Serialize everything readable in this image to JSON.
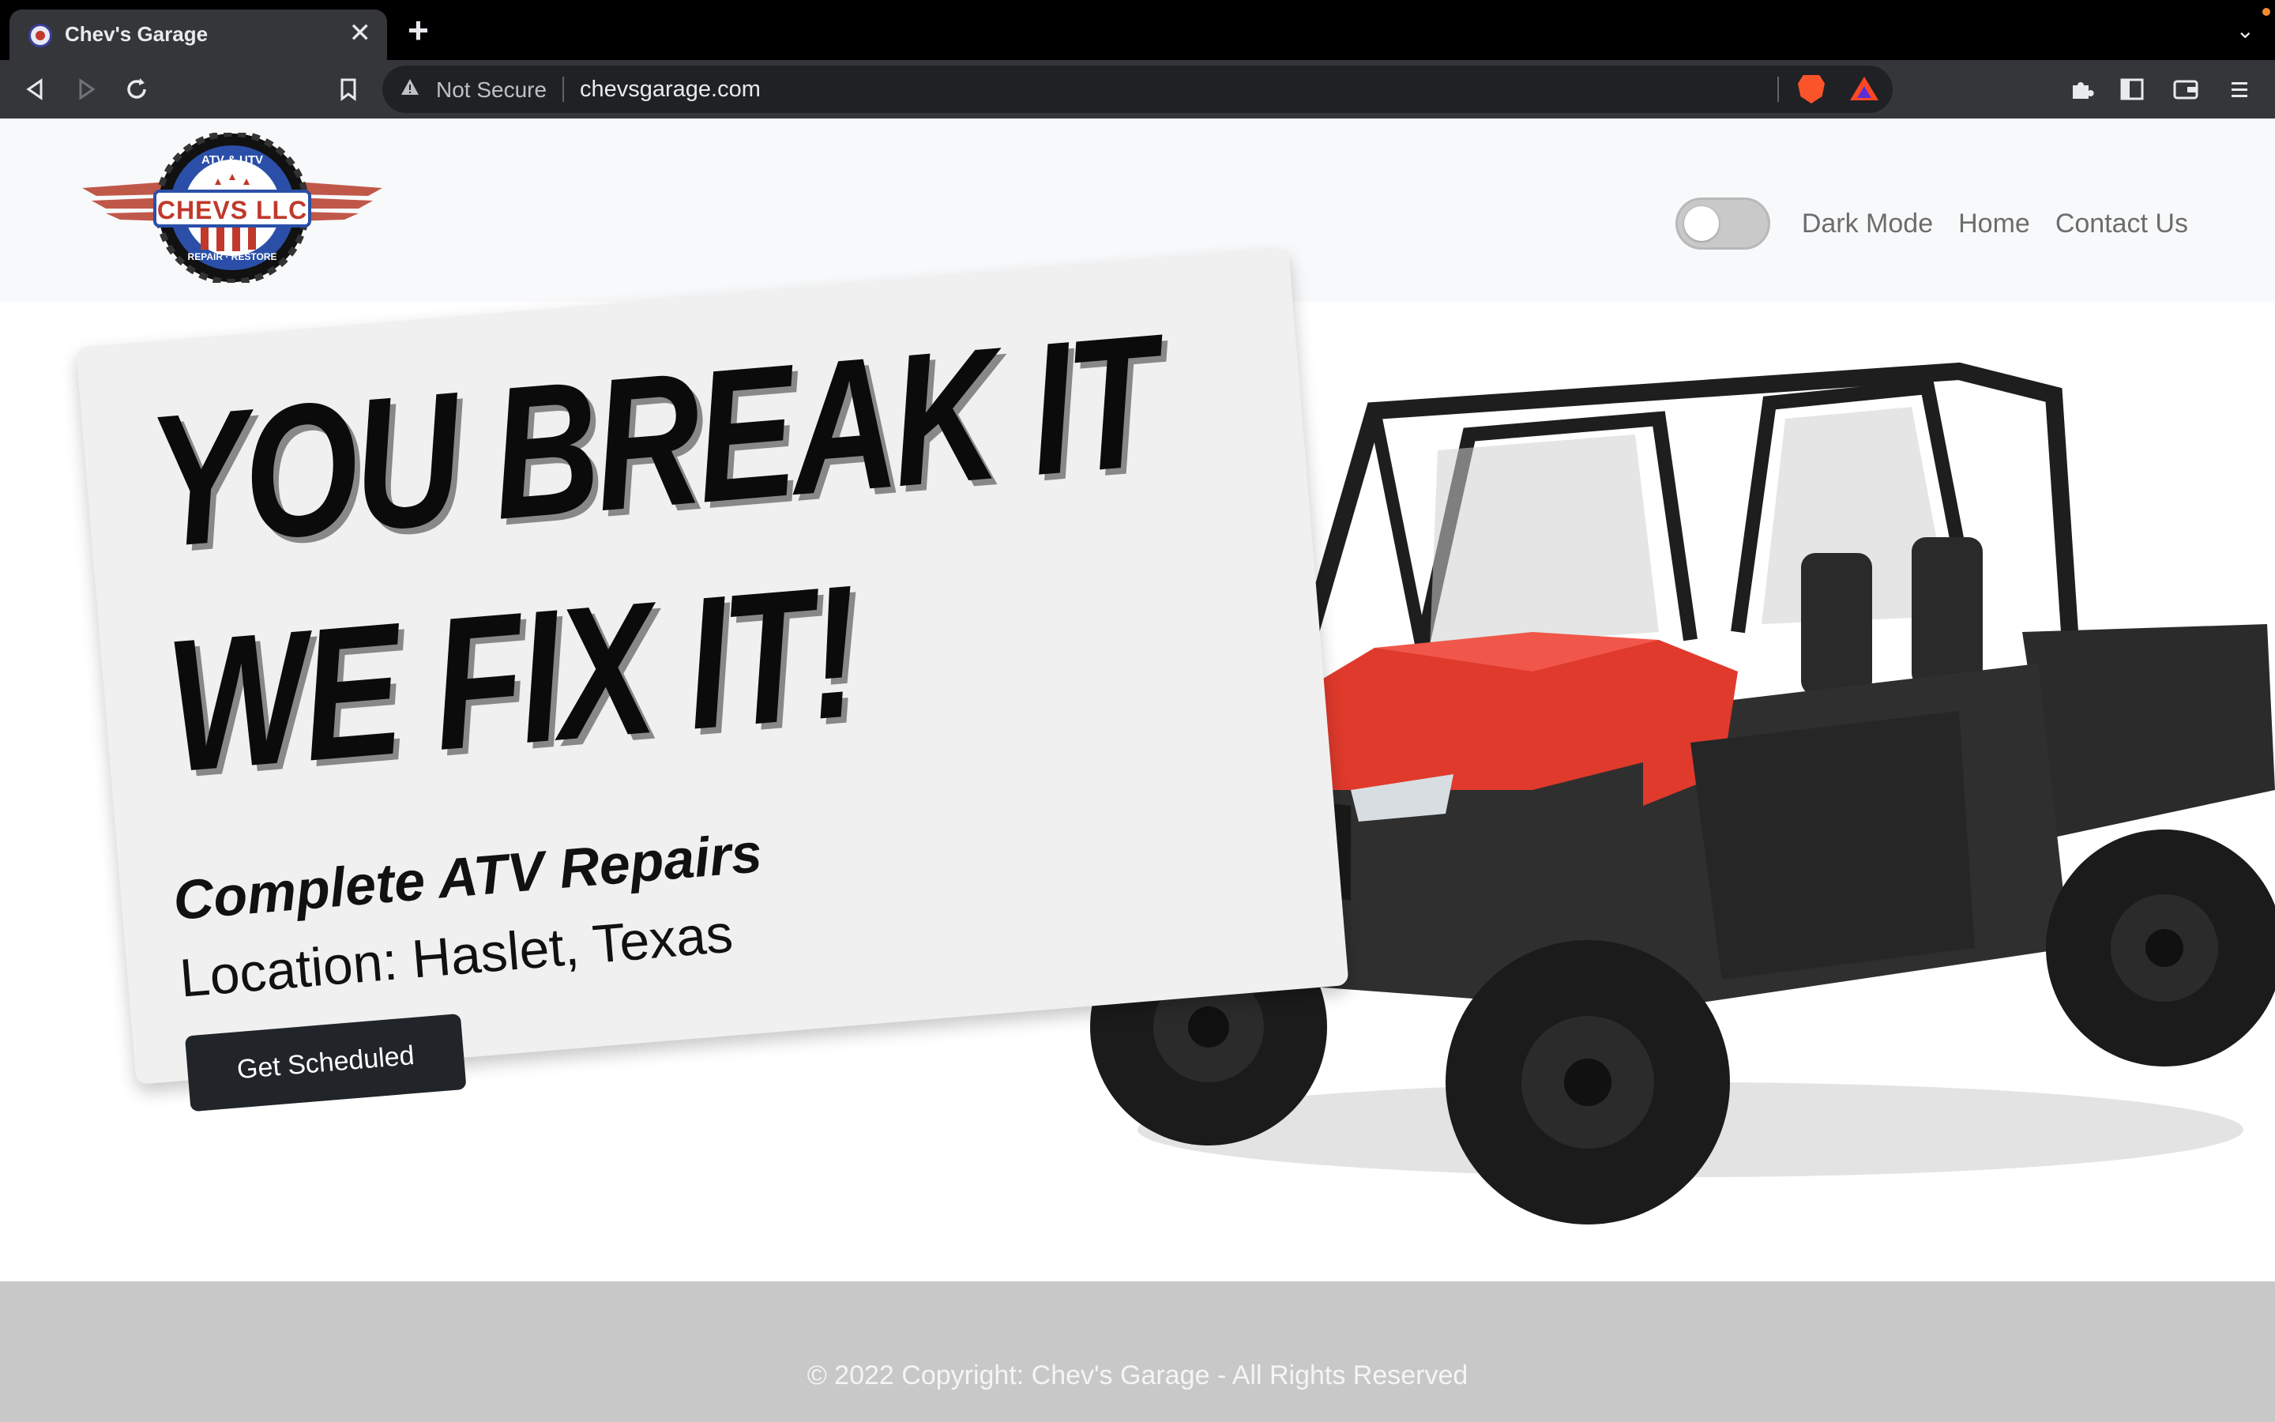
{
  "browser": {
    "tab_title": "Chev's Garage",
    "tab_close_glyph": "✕",
    "new_tab_glyph": "+",
    "tabs_menu_glyph": "⌄",
    "security_label": "Not Secure",
    "url": "chevsgarage.com",
    "nav_icons": [
      "back-icon",
      "forward-icon",
      "reload-icon",
      "bookmark-icon"
    ],
    "extension_icons": [
      "brave-shields-icon",
      "brave-rewards-icon",
      "extensions-icon",
      "sidebar-icon",
      "wallet-icon",
      "menu-icon"
    ]
  },
  "header": {
    "logo": {
      "top_text": "ATV & UTV",
      "main_text": "CHEVS LLC",
      "bottom_text": "REPAIR · RESTORE",
      "colors": {
        "blue": "#2b4fa8",
        "red": "#c0392b",
        "tire": "#111111"
      }
    },
    "dark_mode_label": "Dark Mode",
    "dark_mode_on": false,
    "nav": [
      {
        "label": "Home"
      },
      {
        "label": "Contact Us"
      }
    ]
  },
  "hero": {
    "headline_line1": "YOU BREAK IT",
    "headline_line2": "WE FIX IT!",
    "subheading": "Complete ATV Repairs",
    "location": "Location: Haslet, Texas",
    "cta_label": "Get Scheduled"
  },
  "footer": {
    "copyright": "© 2022 Copyright: Chev's Garage - All Rights Reserved"
  },
  "colors": {
    "header_bg": "#f8f9fa",
    "card_bg": "#f0f0f0",
    "button_bg": "#212529",
    "footer_bg": "#c8c8c8",
    "utv_red": "#e03a2c"
  }
}
